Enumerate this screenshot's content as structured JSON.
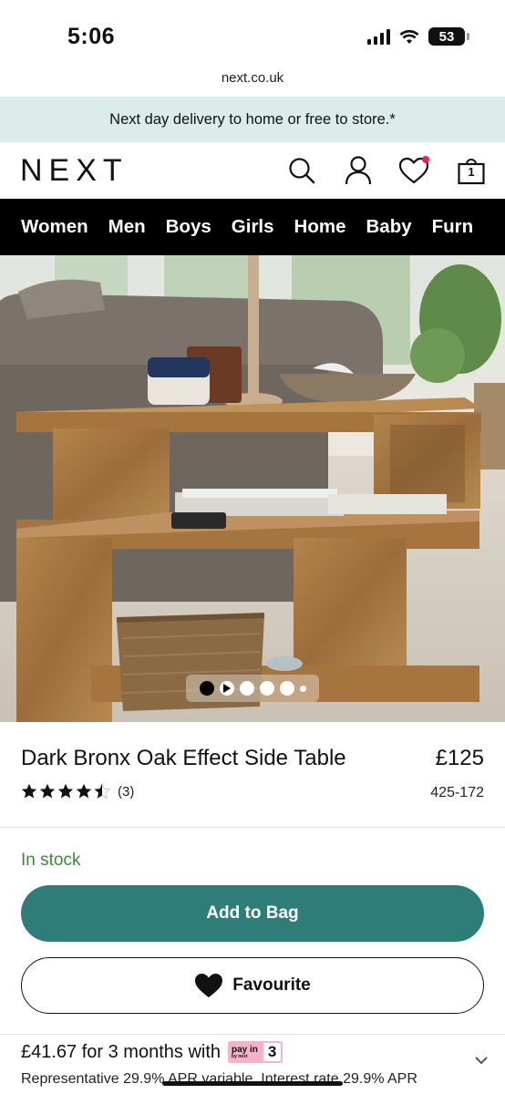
{
  "status_bar": {
    "time": "5:06",
    "battery": "53"
  },
  "browser": {
    "url": "next.co.uk"
  },
  "promo": {
    "text": "Next day delivery to home or free to store.*"
  },
  "header": {
    "logo": "NEXT",
    "icons": [
      "search-icon",
      "account-icon",
      "wishlist-icon",
      "bag-icon"
    ],
    "bag_count": "1"
  },
  "nav": {
    "items": [
      "Women",
      "Men",
      "Boys",
      "Girls",
      "Home",
      "Baby",
      "Furn"
    ]
  },
  "carousel": {
    "slides": 5,
    "active": 0
  },
  "product": {
    "title": "Dark Bronx Oak Effect Side Table",
    "price": "£125",
    "rating_stars": "★★★★★",
    "rating_value": 4.5,
    "review_count": "(3)",
    "item_number": "425-172",
    "stock": "In stock",
    "add_to_bag_label": "Add to Bag",
    "favourite_label": "Favourite"
  },
  "finance": {
    "installment_text": "£41.67 for 3 months with",
    "badge_top": "pay in",
    "badge_sub": "by next",
    "badge_number": "3",
    "representative_text": "Representative 29.9% APR variable. Interest rate 29.9% APR"
  },
  "colors": {
    "accent": "#2e7d78",
    "stock_green": "#3b8a3b",
    "promo_bg": "#dcecea",
    "nav_bg": "#000000",
    "payin_pink": "#f4b3c6"
  }
}
